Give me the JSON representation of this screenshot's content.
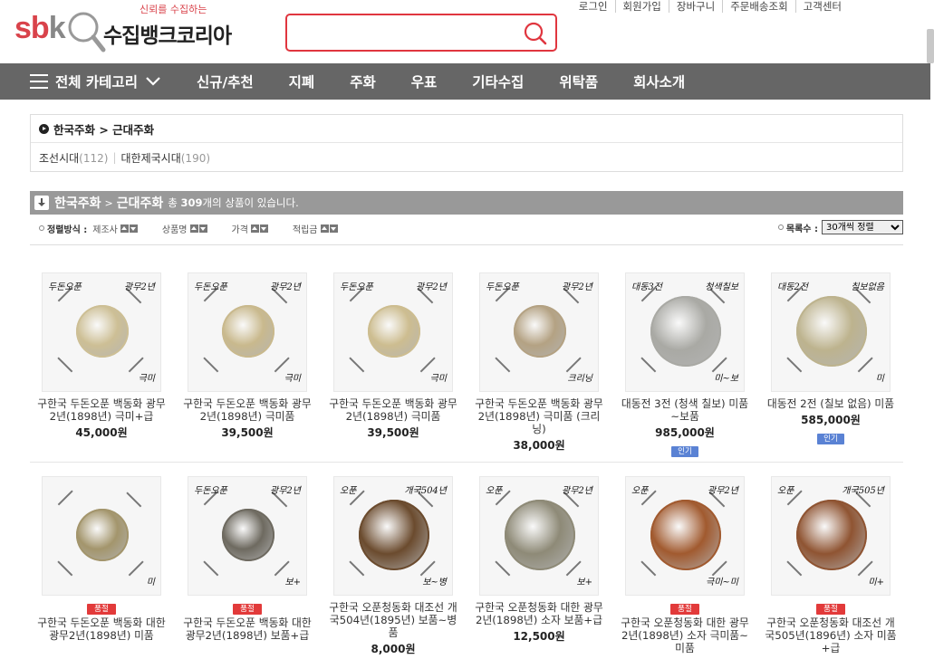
{
  "header": {
    "slogan": "신뢰를 수집하는",
    "logo_sbk_s": "sb",
    "logo_sbk_k": "k",
    "brand": "수집뱅크코리아",
    "search_placeholder": "",
    "toplinks": [
      "로그인",
      "회원가입",
      "장바구니",
      "주문배송조회",
      "고객센터"
    ]
  },
  "nav": {
    "all_category": "전체 카테고리",
    "items": [
      "신규/추천",
      "지폐",
      "주화",
      "우표",
      "기타수집",
      "위탁품",
      "회사소개"
    ]
  },
  "breadcrumb": {
    "path": "한국주화 > 근대주화",
    "subs": [
      {
        "label": "조선시대",
        "count": "(112)"
      },
      {
        "label": "대한제국시대",
        "count": "(190)"
      }
    ]
  },
  "listing": {
    "cat1": "한국주화",
    "gt": ">",
    "cat2": "근대주화",
    "desc_pre": "총",
    "total": "309",
    "desc_post": "개의 상품이 있습니다."
  },
  "sort": {
    "label": "정렬방식 :",
    "options": [
      "제조사",
      "상품명",
      "가격",
      "적립금"
    ],
    "per_page_label": "목록수 :",
    "per_page_value": "30개씩 정렬"
  },
  "colors": {
    "accent": "#e0363f",
    "nav_bg": "#666666",
    "sold_badge": "#e23a3a",
    "popular_badge": "#5a82d4"
  },
  "products": [
    {
      "name": "구한국 두돈오푼 백동화 광무2년(1898년) 극미+급",
      "price": "45,000원",
      "badge": "",
      "popular": "",
      "coin": "#cdbf95",
      "handL": "두돈오푼",
      "handR": "광무2년",
      "handB": "극미"
    },
    {
      "name": "구한국 두돈오푼 백동화 광무2년(1898년) 극미품",
      "price": "39,500원",
      "badge": "",
      "popular": "",
      "coin": "#c9b98d",
      "handL": "두돈오푼",
      "handR": "광무2년",
      "handB": "극미"
    },
    {
      "name": "구한국 두돈오푼 백동화 광무2년(1898년) 극미품",
      "price": "39,500원",
      "badge": "",
      "popular": "",
      "coin": "#cdbd90",
      "handL": "두돈오푼",
      "handR": "광무2년",
      "handB": "극미"
    },
    {
      "name": "구한국 두돈오푼 백동화 광무2년(1898년) 극미품 (크리닝)",
      "price": "38,000원",
      "badge": "",
      "popular": "",
      "coin": "#b4a283",
      "handL": "두돈오푼",
      "handR": "광무2년",
      "handB": "크리닝"
    },
    {
      "name": "대동전 3전 (청색 칠보) 미품~보품",
      "price": "985,000원",
      "badge": "",
      "popular": "인기",
      "coin": "#a9a9a4",
      "handL": "대동3전",
      "handR": "청색칠보",
      "handB": "미~보"
    },
    {
      "name": "대동전 2전 (칠보 없음) 미품",
      "price": "585,000원",
      "badge": "",
      "popular": "인기",
      "coin": "#bdb38e",
      "handL": "대동2전",
      "handR": "칠보없음",
      "handB": "미"
    },
    {
      "name": "구한국 두돈오푼 백동화 대한광무2년(1898년) 미품",
      "price": "",
      "badge": "품절",
      "popular": "",
      "coin": "#a3956c",
      "handL": "",
      "handR": "",
      "handB": "미"
    },
    {
      "name": "구한국 두돈오푼 백동화 대한광무2년(1898년) 보품+급",
      "price": "",
      "badge": "품절",
      "popular": "",
      "coin": "#6e6a60",
      "handL": "두돈오푼",
      "handR": "광무2년",
      "handB": "보+"
    },
    {
      "name": "구한국 오푼청동화 대조선 개국504년(1895년) 보품~병품",
      "price": "8,000원",
      "badge": "",
      "popular": "",
      "coin": "#6b4b2e",
      "handL": "오푼",
      "handR": "개국504년",
      "handB": "보~병"
    },
    {
      "name": "구한국 오푼청동화 대한 광무2년(1898년) 소자 보품+급",
      "price": "12,500원",
      "badge": "",
      "popular": "",
      "coin": "#8e8a77",
      "handL": "오푼",
      "handR": "광무2년",
      "handB": "보+"
    },
    {
      "name": "구한국 오푼청동화 대한 광무2년(1898년) 소자 극미품~미품",
      "price": "",
      "badge": "품절",
      "popular": "",
      "coin": "#a15a2f",
      "handL": "오푼",
      "handR": "광무2년",
      "handB": "극미~미"
    },
    {
      "name": "구한국 오푼청동화 대조선 개국505년(1896년) 소자 미품+급",
      "price": "",
      "badge": "품절",
      "popular": "",
      "coin": "#8f5432",
      "handL": "오푼",
      "handR": "개국505년",
      "handB": "미+"
    }
  ]
}
